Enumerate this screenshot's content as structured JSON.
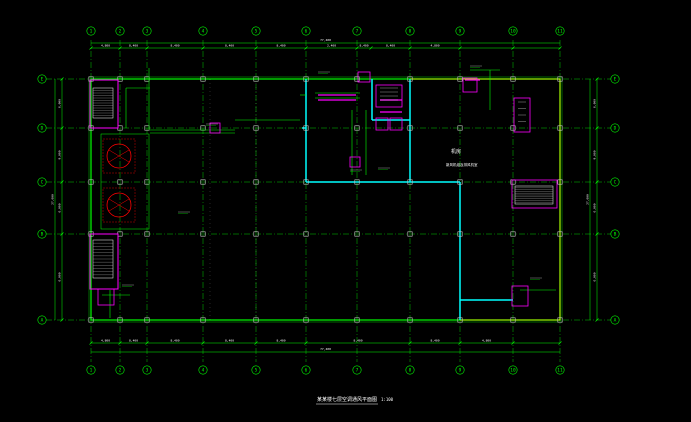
{
  "drawing": {
    "title": "某某楼七层空调通风平面图",
    "scale": "1:100",
    "room_label": "机房",
    "room_sublabel": "新风机组及排风机室",
    "col_axes": [
      "1",
      "2",
      "3",
      "4",
      "5",
      "6",
      "7",
      "8",
      "9",
      "10",
      "11"
    ],
    "row_axes": [
      "E",
      "D",
      "C",
      "B",
      "A"
    ],
    "dim_top": [
      "4,800",
      "8,400",
      "8,400",
      "8,400",
      "8,400",
      "2,400",
      "8,400",
      "8,400",
      "4,800"
    ],
    "dim_bottom": [
      "4,800",
      "8,400",
      "8,400",
      "8,400",
      "8,400",
      "8,400",
      "8,400",
      "4,800"
    ],
    "total_dim": "77,400",
    "dim_left": [
      "6,000",
      "9,000",
      "6,000",
      "6,000"
    ],
    "total_left": "27,000",
    "colors": {
      "grid": "#00ff00",
      "wall": "#00ffff",
      "equipment": "#ff00ff",
      "hatch": "#ffff00",
      "text": "#ffffff",
      "duct_red": "#ff0000"
    }
  }
}
